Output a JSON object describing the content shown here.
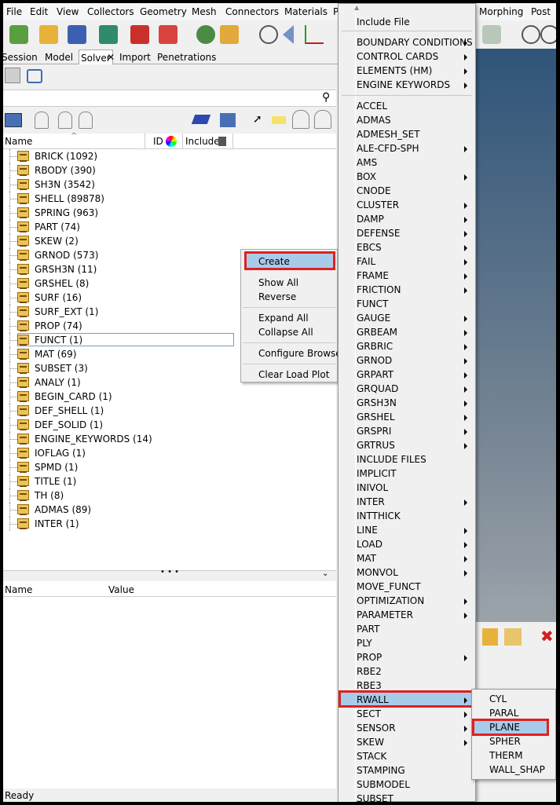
{
  "menubar": [
    "File",
    "Edit",
    "View",
    "Collectors",
    "Geometry",
    "Mesh",
    "Connectors",
    "Materials",
    "P",
    "Morphing",
    "Post"
  ],
  "tabs": [
    "Session",
    "Model",
    "Solver",
    "Import",
    "Penetrations"
  ],
  "tree_header": {
    "name": "Name",
    "id": "ID",
    "include": "Include"
  },
  "tree": [
    "BRICK  (1092)",
    "RBODY  (390)",
    "SH3N  (3542)",
    "SHELL  (89878)",
    "SPRING  (963)",
    "PART  (74)",
    "SKEW  (2)",
    "GRNOD  (573)",
    "GRSH3N  (11)",
    "GRSHEL  (8)",
    "SURF  (16)",
    "SURF_EXT  (1)",
    "PROP  (74)",
    "FUNCT  (1)",
    "MAT  (69)",
    "SUBSET  (3)",
    "ANALY  (1)",
    "BEGIN_CARD  (1)",
    "DEF_SHELL  (1)",
    "DEF_SOLID  (1)",
    "ENGINE_KEYWORDS  (14)",
    "IOFLAG  (1)",
    "SPMD  (1)",
    "TITLE  (1)",
    "TH  (8)",
    "ADMAS  (89)",
    "INTER  (1)"
  ],
  "selected_tree_index": 13,
  "name_value": {
    "name": "Name",
    "value": "Value"
  },
  "status": "Ready",
  "context_menu": [
    "Create",
    "Show All",
    "Reverse",
    "Expand All",
    "Collapse All",
    "Configure Browser",
    "Clear Load Plot"
  ],
  "big_menu": {
    "top": "Include File",
    "group1": [
      {
        "label": "BOUNDARY CONDITIONS",
        "sub": true
      },
      {
        "label": "CONTROL CARDS",
        "sub": true
      },
      {
        "label": "ELEMENTS (HM)",
        "sub": true
      },
      {
        "label": "ENGINE KEYWORDS",
        "sub": true
      }
    ],
    "group2": [
      {
        "label": "ACCEL",
        "sub": false
      },
      {
        "label": "ADMAS",
        "sub": false
      },
      {
        "label": "ADMESH_SET",
        "sub": false
      },
      {
        "label": "ALE-CFD-SPH",
        "sub": true
      },
      {
        "label": "AMS",
        "sub": false
      },
      {
        "label": "BOX",
        "sub": true
      },
      {
        "label": "CNODE",
        "sub": false
      },
      {
        "label": "CLUSTER",
        "sub": true
      },
      {
        "label": "DAMP",
        "sub": true
      },
      {
        "label": "DEFENSE",
        "sub": true
      },
      {
        "label": "EBCS",
        "sub": true
      },
      {
        "label": "FAIL",
        "sub": true
      },
      {
        "label": "FRAME",
        "sub": true
      },
      {
        "label": "FRICTION",
        "sub": true
      },
      {
        "label": "FUNCT",
        "sub": false
      },
      {
        "label": "GAUGE",
        "sub": true
      },
      {
        "label": "GRBEAM",
        "sub": true
      },
      {
        "label": "GRBRIC",
        "sub": true
      },
      {
        "label": "GRNOD",
        "sub": true
      },
      {
        "label": "GRPART",
        "sub": true
      },
      {
        "label": "GRQUAD",
        "sub": true
      },
      {
        "label": "GRSH3N",
        "sub": true
      },
      {
        "label": "GRSHEL",
        "sub": true
      },
      {
        "label": "GRSPRI",
        "sub": true
      },
      {
        "label": "GRTRUS",
        "sub": true
      },
      {
        "label": "INCLUDE FILES",
        "sub": false
      },
      {
        "label": "IMPLICIT",
        "sub": false
      },
      {
        "label": "INIVOL",
        "sub": false
      },
      {
        "label": "INTER",
        "sub": true
      },
      {
        "label": "INTTHICK",
        "sub": false
      },
      {
        "label": "LINE",
        "sub": true
      },
      {
        "label": "LOAD",
        "sub": true
      },
      {
        "label": "MAT",
        "sub": true
      },
      {
        "label": "MONVOL",
        "sub": true
      },
      {
        "label": "MOVE_FUNCT",
        "sub": false
      },
      {
        "label": "OPTIMIZATION",
        "sub": true
      },
      {
        "label": "PARAMETER",
        "sub": true
      },
      {
        "label": "PART",
        "sub": false
      },
      {
        "label": "PLY",
        "sub": false
      },
      {
        "label": "PROP",
        "sub": true
      },
      {
        "label": "RBE2",
        "sub": false
      },
      {
        "label": "RBE3",
        "sub": false
      },
      {
        "label": "RWALL",
        "sub": true
      },
      {
        "label": "SECT",
        "sub": true
      },
      {
        "label": "SENSOR",
        "sub": true
      },
      {
        "label": "SKEW",
        "sub": true
      },
      {
        "label": "STACK",
        "sub": false
      },
      {
        "label": "STAMPING",
        "sub": false
      },
      {
        "label": "SUBMODEL",
        "sub": false
      },
      {
        "label": "SUBSET",
        "sub": false
      }
    ]
  },
  "submenu": [
    "CYL",
    "PARAL",
    "PLANE",
    "SPHER",
    "THERM",
    "WALL_SHAP"
  ],
  "colors": {
    "highlight": "#a9cbea",
    "redbox": "#e02020",
    "folder": "#e9c45a"
  }
}
